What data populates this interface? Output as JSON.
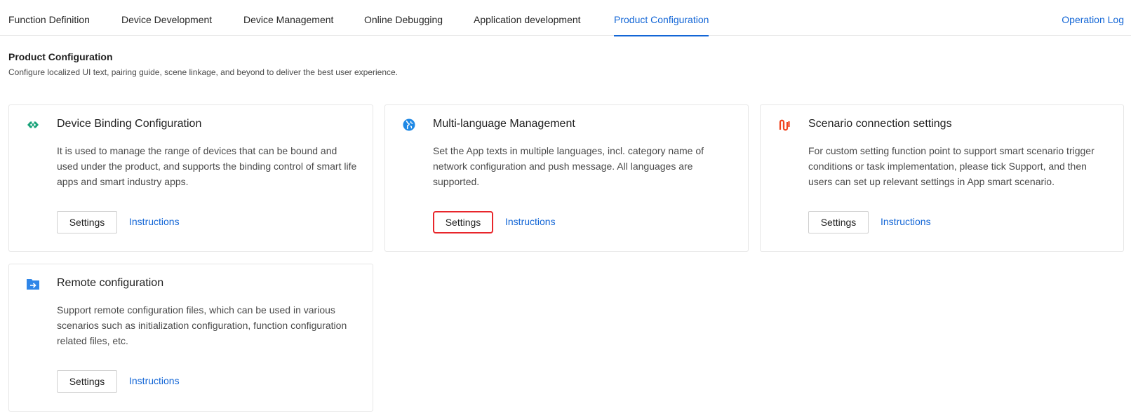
{
  "tabs": [
    {
      "label": "Function Definition",
      "active": false
    },
    {
      "label": "Device Development",
      "active": false
    },
    {
      "label": "Device Management",
      "active": false
    },
    {
      "label": "Online Debugging",
      "active": false
    },
    {
      "label": "Application development",
      "active": false
    },
    {
      "label": "Product Configuration",
      "active": true
    }
  ],
  "operation_log_label": "Operation Log",
  "header": {
    "title": "Product Configuration",
    "description": "Configure localized UI text, pairing guide, scene linkage, and beyond to deliver the best user experience."
  },
  "cards": [
    {
      "icon": "link-icon",
      "icon_color": "#1aa37a",
      "title": "Device Binding Configuration",
      "description": "It is used to manage the range of devices that can be bound and used under the product, and supports the binding control of smart life apps and smart industry apps.",
      "settings_label": "Settings",
      "instructions_label": "Instructions"
    },
    {
      "icon": "globe-icon",
      "icon_color": "#1e88e5",
      "title": "Multi-language Management",
      "description": "Set the App texts in multiple languages, incl. category name of network configuration and push message. All languages are supported.",
      "settings_label": "Settings",
      "instructions_label": "Instructions",
      "highlighted": true
    },
    {
      "icon": "scenario-link-icon",
      "icon_color": "#f0441f",
      "title": "Scenario connection settings",
      "description": "For custom setting function point to support smart scenario trigger conditions or task implementation, please tick Support, and then users can set up relevant settings in App smart scenario.",
      "settings_label": "Settings",
      "instructions_label": "Instructions"
    },
    {
      "icon": "folder-arrow-icon",
      "icon_color": "#2f86e8",
      "title": "Remote configuration",
      "description": "Support remote configuration files, which can be used in various scenarios such as initialization configuration, function configuration related files, etc.",
      "settings_label": "Settings",
      "instructions_label": "Instructions"
    }
  ],
  "colors": {
    "accent": "#1366d6",
    "highlight_border": "#e8262b"
  }
}
